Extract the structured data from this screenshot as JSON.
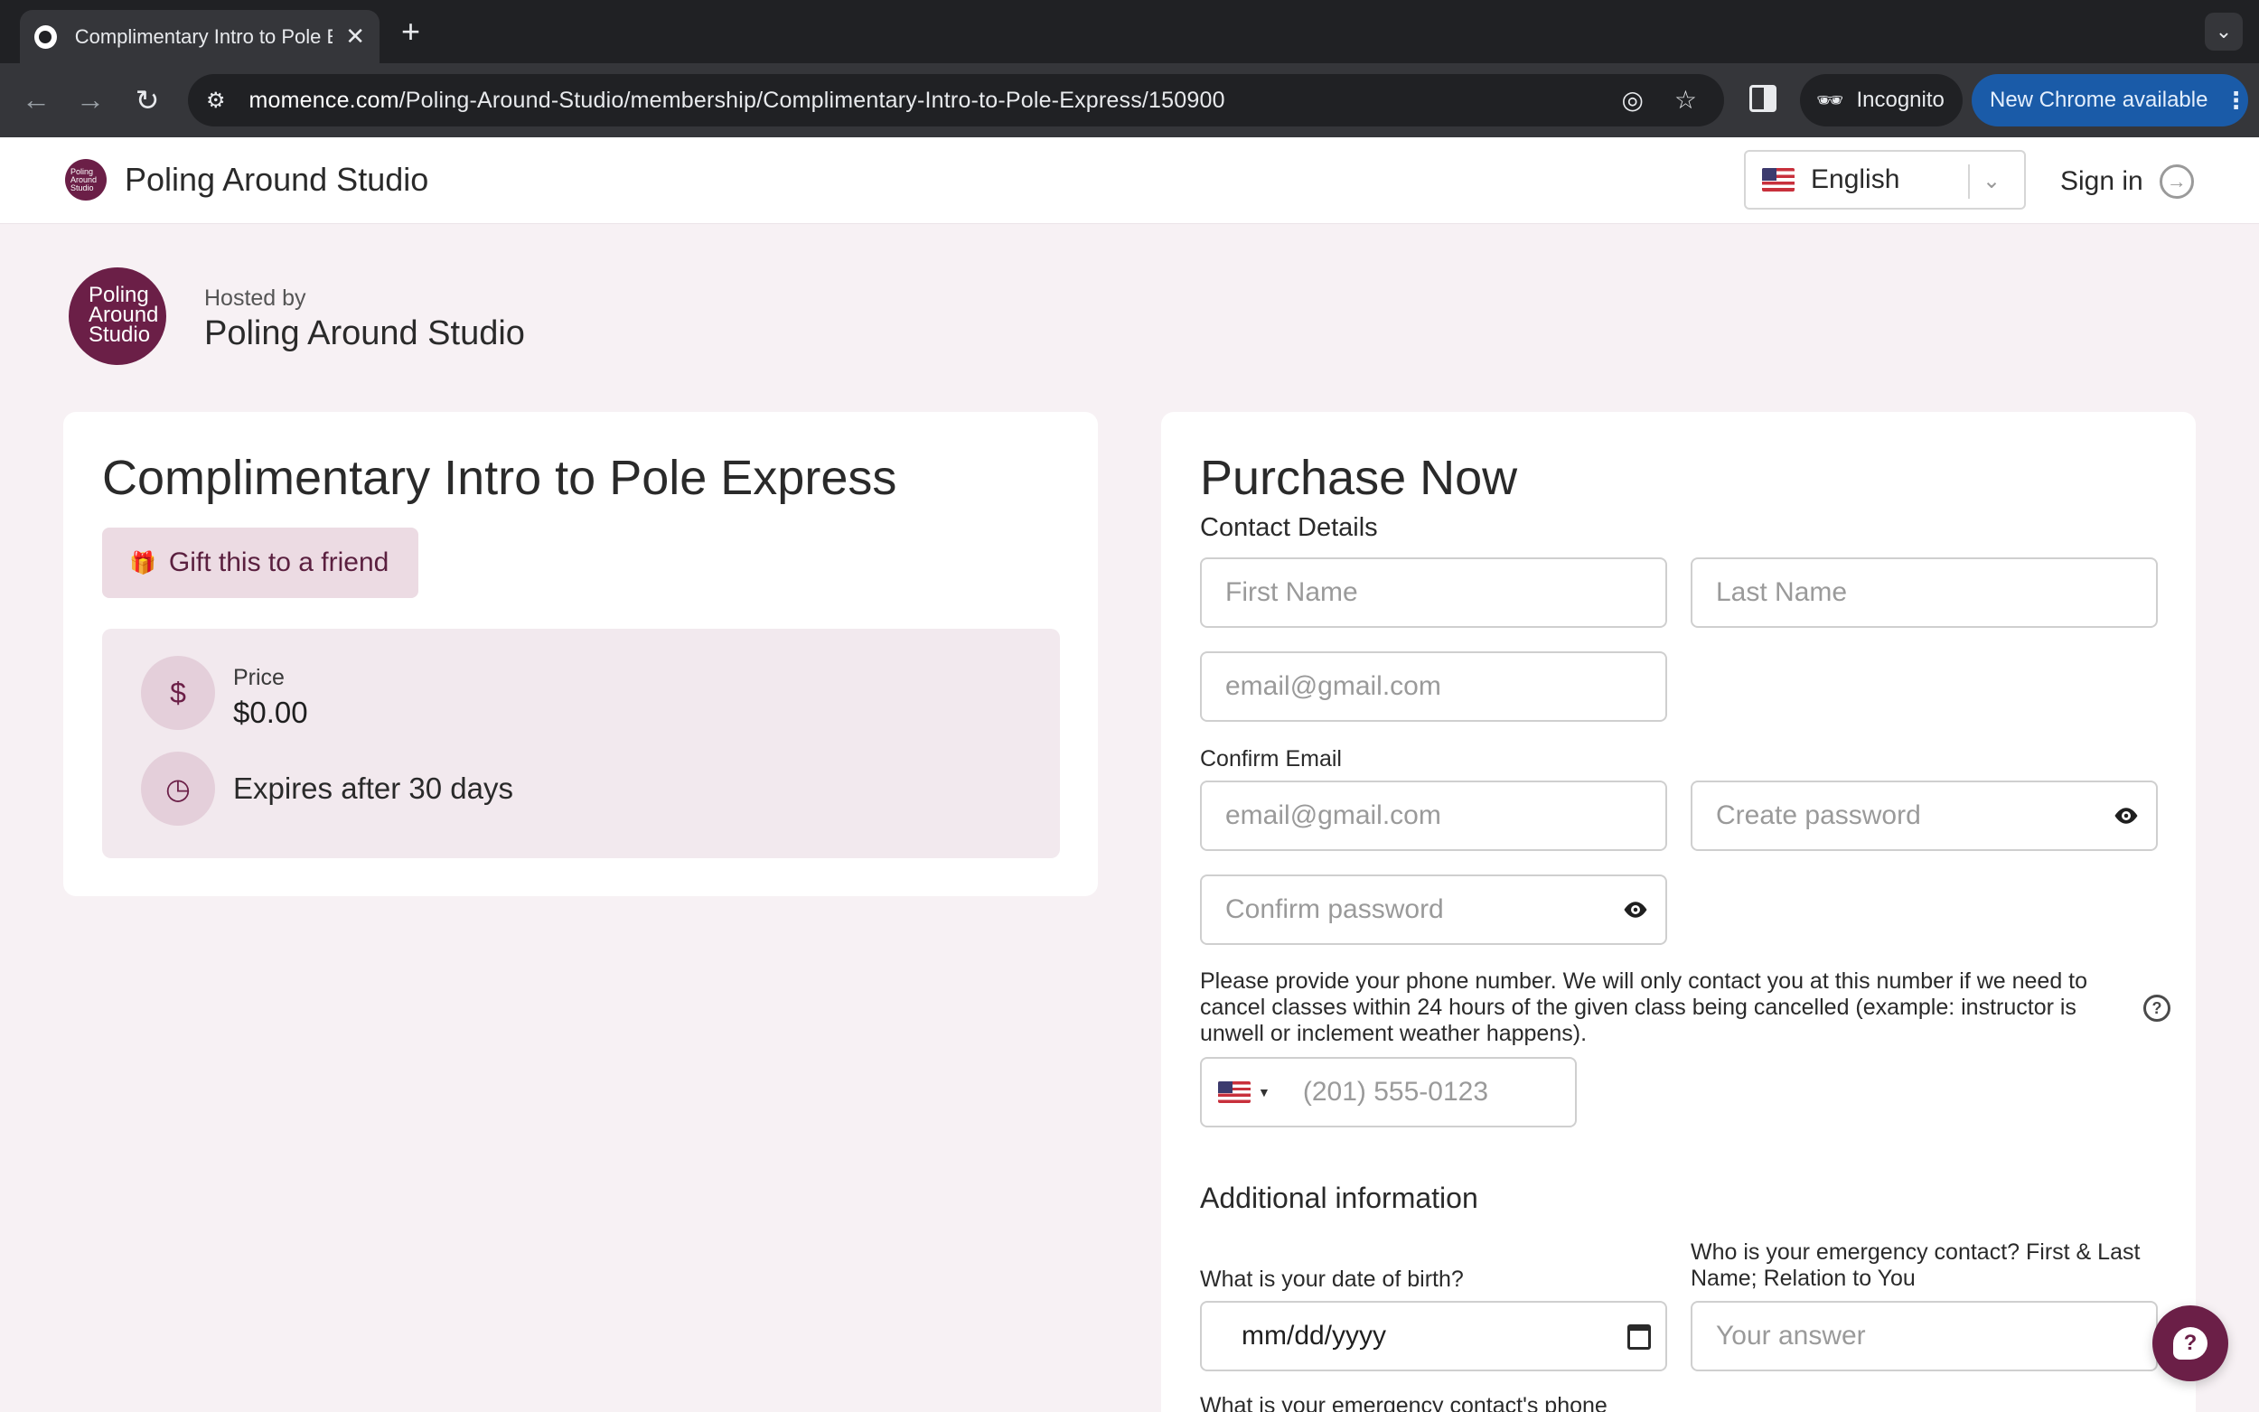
{
  "browser": {
    "tab_title": "Complimentary Intro to Pole E",
    "new_tab_symbol": "+",
    "url_host": "momence.com",
    "url_path": "/Poling-Around-Studio/membership/Complimentary-Intro-to-Pole-Express/150900",
    "incognito_label": "Incognito",
    "update_label": "New Chrome available"
  },
  "header": {
    "logo_text": "Poling Around Studio",
    "site_name": "Poling Around Studio",
    "language": "English",
    "signin_label": "Sign in"
  },
  "host": {
    "logo_text": "Poling Around Studio",
    "hosted_by_label": "Hosted by",
    "name": "Poling Around Studio"
  },
  "membership": {
    "title": "Complimentary Intro to Pole Express",
    "gift_label": "Gift this to a friend",
    "price_label": "Price",
    "price_value": "$0.00",
    "expires_label": "Expires after 30 days"
  },
  "purchase": {
    "title": "Purchase Now",
    "contact_heading": "Contact Details",
    "first_name_placeholder": "First Name",
    "last_name_placeholder": "Last Name",
    "email_placeholder": "email@gmail.com",
    "confirm_email_label": "Confirm Email",
    "confirm_email_placeholder": "email@gmail.com",
    "create_password_placeholder": "Create password",
    "confirm_password_placeholder": "Confirm password",
    "phone_note": "Please provide your phone number. We will only contact you at this number if we need to cancel classes within 24 hours of the given class being cancelled (example: instructor is unwell or inclement weather happens).",
    "phone_placeholder": "(201) 555-0123",
    "additional_heading": "Additional information",
    "dob_label": "What is your date of birth?",
    "dob_value": "mm/dd/yyyy",
    "emergency_label": "Who is your emergency contact? First & Last Name; Relation to You",
    "emergency_placeholder": "Your answer",
    "emergency_phone_label": "What is your emergency contact's phone"
  },
  "colors": {
    "brand": "#6b1f47",
    "page_bg": "#f7f1f4",
    "chrome_blue": "#1a5ba8"
  },
  "icons": [
    "gift-icon",
    "dollar-icon",
    "clock-icon",
    "eye-icon",
    "help-icon",
    "calendar-icon",
    "chat-icon",
    "signin-icon"
  ]
}
